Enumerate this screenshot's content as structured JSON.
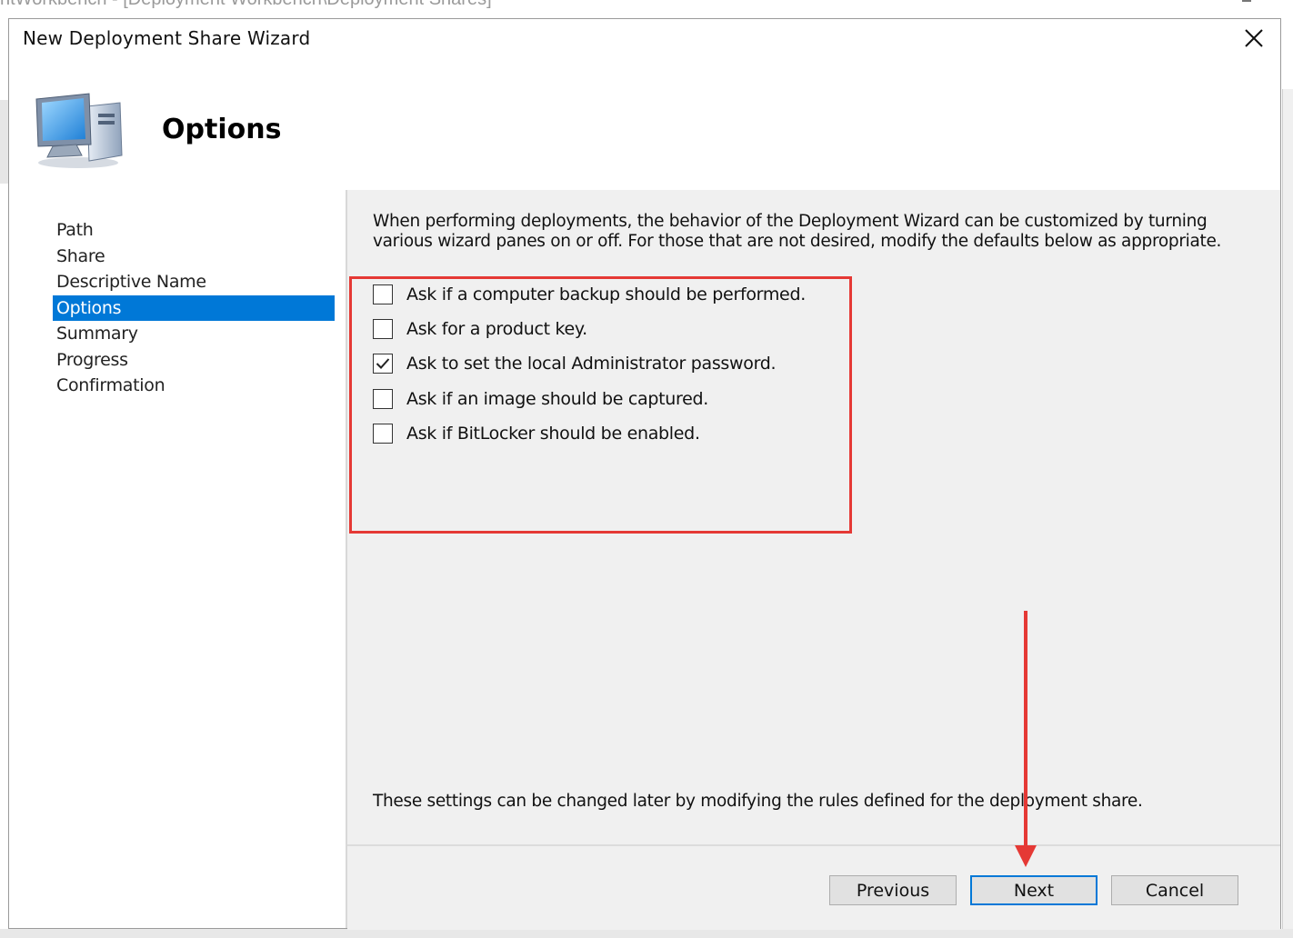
{
  "background": {
    "window_title": "ntWorkbench - [Deployment Workbench\\Deployment Shares]"
  },
  "dialog": {
    "title": "New Deployment Share Wizard",
    "header_title": "Options",
    "header_icon": "computer-icon",
    "close_icon": "close-icon"
  },
  "nav": {
    "items": [
      {
        "label": "Path",
        "active": false
      },
      {
        "label": "Share",
        "active": false
      },
      {
        "label": "Descriptive Name",
        "active": false
      },
      {
        "label": "Options",
        "active": true
      },
      {
        "label": "Summary",
        "active": false
      },
      {
        "label": "Progress",
        "active": false
      },
      {
        "label": "Confirmation",
        "active": false
      }
    ]
  },
  "content": {
    "intro_line1": "When performing deployments, the behavior of the Deployment Wizard can be customized by turning",
    "intro_line2": "various wizard panes on or off.  For those that are not desired, modify the defaults below as appropriate.",
    "options": [
      {
        "label": "Ask if a computer backup should be performed.",
        "checked": false
      },
      {
        "label": "Ask for a product key.",
        "checked": false
      },
      {
        "label": "Ask to set the local Administrator password.",
        "checked": true
      },
      {
        "label": "Ask if an image should be captured.",
        "checked": false
      },
      {
        "label": "Ask if BitLocker should be enabled.",
        "checked": false
      }
    ],
    "footnote": "These settings can be changed later by modifying the rules defined for the deployment share."
  },
  "buttons": {
    "previous": "Previous",
    "next": "Next",
    "cancel": "Cancel"
  },
  "annotation_color": "#e53935",
  "accent_color": "#0078d7"
}
